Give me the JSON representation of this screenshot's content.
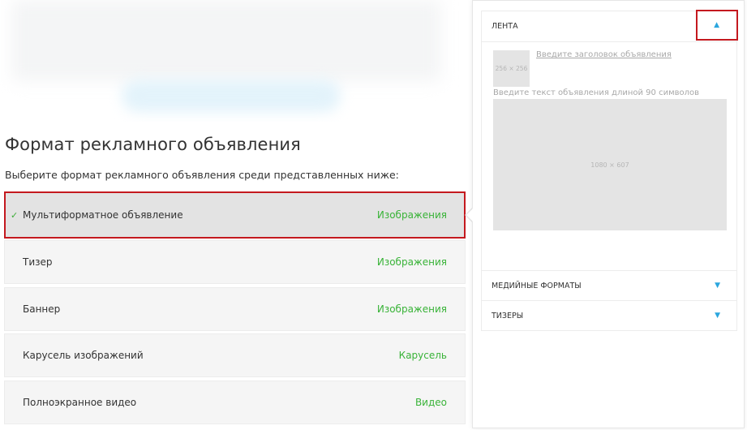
{
  "left": {
    "title": "Формат рекламного объявления",
    "subtitle": "Выберите формат рекламного объявления среди представленных ниже:",
    "formats": [
      {
        "name": "Мультиформатное объявление",
        "type": "Изображения",
        "selected": true
      },
      {
        "name": "Тизер",
        "type": "Изображения",
        "selected": false
      },
      {
        "name": "Баннер",
        "type": "Изображения",
        "selected": false
      },
      {
        "name": "Карусель изображений",
        "type": "Карусель",
        "selected": false
      },
      {
        "name": "Полноэкранное видео",
        "type": "Видео",
        "selected": false
      }
    ],
    "check_icon": "✓"
  },
  "preview": {
    "sections": [
      {
        "label": "ЛЕНТА",
        "expanded": true,
        "arrow": "▲"
      },
      {
        "label": "МЕДИЙНЫЕ ФОРМАТЫ",
        "expanded": false,
        "arrow": "▼"
      },
      {
        "label": "ТИЗЕРЫ",
        "expanded": false,
        "arrow": "▼"
      }
    ],
    "thumb_size": "256 × 256",
    "ad_title_placeholder": "Введите заголовок объявления",
    "ad_text_placeholder": "Введите текст объявления длиной 90 символов",
    "image_size": "1080 × 607"
  },
  "colors": {
    "accent_green": "#39b338",
    "accent_blue": "#2ba6de",
    "highlight_red": "#c4191f"
  }
}
